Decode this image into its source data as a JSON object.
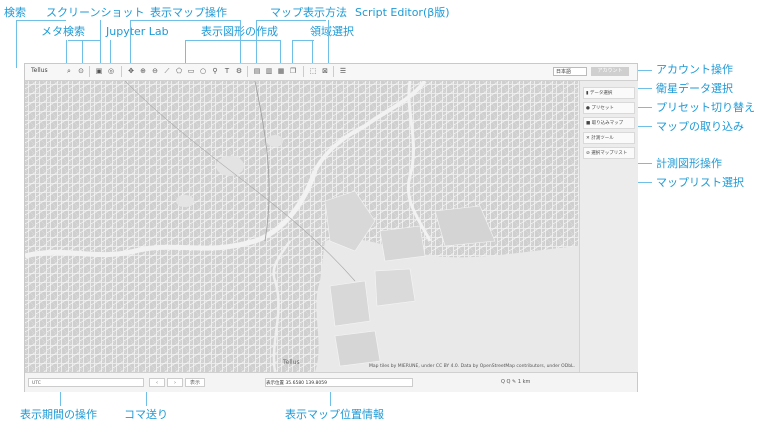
{
  "annotations": {
    "search": "検索",
    "screenshot": "スクリーンショット",
    "display_map_ops": "表示マップ操作",
    "map_display_method": "マップ表示方法",
    "script_editor": "Script Editor(β版)",
    "meta_search": "メタ検索",
    "jupyter_lab": "Jupyter Lab",
    "create_shapes": "表示図形の作成",
    "region_select": "領域選択",
    "account_ops": "アカウント操作",
    "satellite_select": "衛星データ選択",
    "preset_switch": "プリセット切り替え",
    "map_import": "マップの取り込み",
    "measure_ops": "計測図形操作",
    "map_list_select": "マップリスト選択",
    "period_ops": "表示期間の操作",
    "frame_step": "コマ送り",
    "map_position_info": "表示マップ位置情報"
  },
  "app": {
    "logo": "Tellus",
    "toolbar_icons": [
      "search-icon",
      "meta-search-icon",
      "screenshot-icon",
      "jupyter-icon",
      "move-icon",
      "zoom-in-icon",
      "zoom-out-icon",
      "line-icon",
      "polygon-icon",
      "rect-icon",
      "circle-icon",
      "marker-icon",
      "text-icon",
      "settings-icon",
      "split-view-icon",
      "compare-view-icon",
      "layer-view-icon",
      "stack-view-icon",
      "region-select-icon",
      "region-clear-icon",
      "script-editor-icon"
    ],
    "language": "日本語",
    "account_button": "アカウント",
    "sidebar": [
      {
        "label": "データ選択",
        "icon": "satellite-icon"
      },
      {
        "label": "プリセット",
        "icon": "preset-icon"
      },
      {
        "label": "取り込みマップ",
        "icon": "import-icon"
      },
      {
        "label": "計測ツール",
        "icon": "measure-icon"
      },
      {
        "label": "選択マップリスト",
        "icon": "list-icon"
      }
    ],
    "attribution": "Map tiles by MIERUNE, under CC BY 4.0. Data by OpenStreetMap contributors, under ODbL.",
    "map_logo": "Tellus",
    "bottom": {
      "period": "UTC",
      "frame_prev": "‹",
      "frame_next": "›",
      "frame_label": "表示",
      "coord_prefix": "表示位置",
      "coord_value": "35.6580 139.8059",
      "zoom_label": "Q  Q  ✎ 1 km"
    }
  }
}
